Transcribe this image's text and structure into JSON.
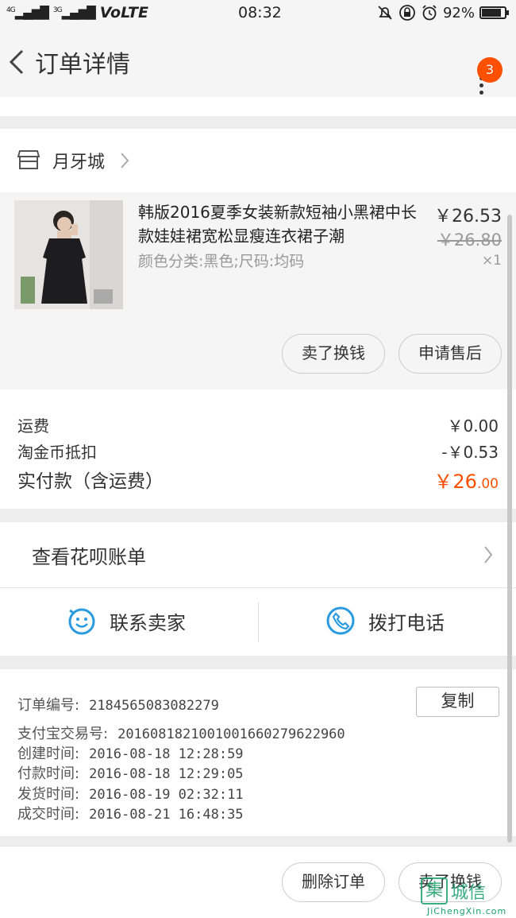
{
  "status_bar": {
    "signal_1": "⁴ᴳ│▏▐",
    "signal_1_label": "4G",
    "signal_2_label": "3G",
    "volte": "VoLTE",
    "time": "08:32",
    "battery": "92%",
    "battery_level": 0.92
  },
  "nav": {
    "title": "订单详情",
    "badge_count": "3"
  },
  "shop": {
    "name": "月牙城"
  },
  "item": {
    "title": "韩版2016夏季女装新款短袖小黑裙中长款娃娃裙宽松显瘦连衣裙子潮",
    "sku": "颜色分类:黑色;尺码:均码",
    "price": "￥26.53",
    "original_price": "￥26.80",
    "quantity": "×1",
    "button_sell": "卖了换钱",
    "button_aftersale": "申请售后"
  },
  "summary": {
    "shipping_label": "运费",
    "shipping_value": "￥0.00",
    "coin_label": "淘金币抵扣",
    "coin_value": "-￥0.53",
    "total_label": "实付款（含运费）",
    "total_prefix": "￥26",
    "total_decimal": ".00"
  },
  "huabei": {
    "label": "查看花呗账单"
  },
  "contact": {
    "seller_label": "联系卖家",
    "call_label": "拨打电话"
  },
  "order_info": {
    "copy_label": "复制",
    "lines": [
      {
        "key": "订单编号:",
        "value": "2184565083082279"
      },
      {
        "key": "支付宝交易号:",
        "value": "2016081821001001660279622960"
      },
      {
        "key": "创建时间:",
        "value": "2016-08-18 12:28:59"
      },
      {
        "key": "付款时间:",
        "value": "2016-08-18 12:29:05"
      },
      {
        "key": "发货时间:",
        "value": "2016-08-19 02:32:11"
      },
      {
        "key": "成交时间:",
        "value": "2016-08-21 16:48:35"
      }
    ]
  },
  "bottom": {
    "delete_label": "删除订单",
    "sell_label": "卖了换钱"
  },
  "watermark": {
    "logo": "集",
    "text": "城信",
    "sub": "JiChengXin.com"
  },
  "colors": {
    "accent": "#ff5000",
    "icon_blue": "#2a9be0"
  }
}
